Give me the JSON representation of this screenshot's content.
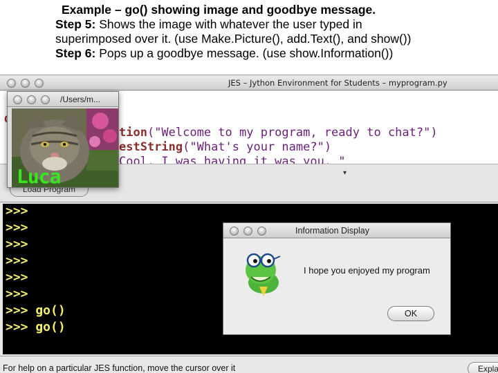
{
  "slide": {
    "title": "Example – go() showing image and goodbye message.",
    "step5_label": "Step 5:",
    "step5_text_line1": " Shows the image with whatever the user typed in",
    "step5_text_line2": "superimposed over it. (use Make.Picture(), add.Text(), and show())",
    "step6_label": "Step 6:",
    "step6_text": " Pops up a goodbye message. (use show.Information())"
  },
  "jes_window": {
    "title": "JES – Jython Environment for Students – myprogram.py",
    "editor": {
      "left_char": "d",
      "line1_fn": "tion",
      "line1_args": "(\"Welcome to my program, ready to chat?\")",
      "line2_fn": "estString",
      "line2_args": "(\"What's your name?\")",
      "line3_partial": "Cool. I was having it was you.  \""
    },
    "load_button_label": "Load Program",
    "console_prompts": [
      ">>>",
      ">>>",
      ">>>",
      ">>>",
      ">>>",
      ">>>",
      ">>> go()",
      ">>> go()"
    ],
    "status_help": "For help on a particular JES function, move the cursor over it",
    "explain_button_label": "Expla"
  },
  "picture_window": {
    "title": "/Users/m...",
    "overlay_text": "Luca"
  },
  "info_dialog": {
    "title": "Information Display",
    "message": "I hope you enjoyed my program",
    "ok_label": "OK"
  },
  "colors": {
    "console_bg": "#000000",
    "console_text": "#f4f06a",
    "overlay_text": "#37e61e",
    "keyword": "#8b2e2e",
    "string": "#6a1f7a"
  }
}
